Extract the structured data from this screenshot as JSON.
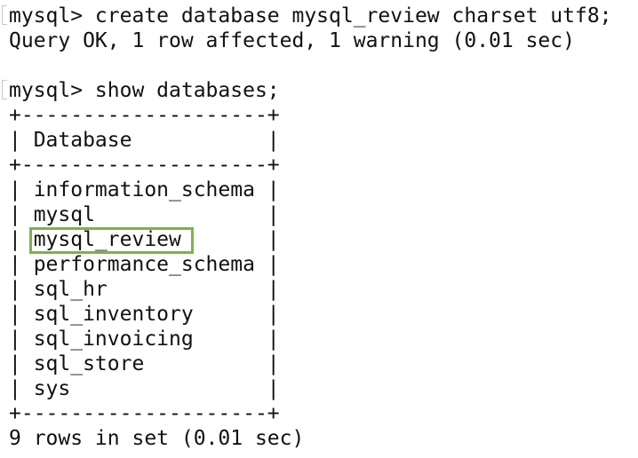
{
  "terminal": {
    "lines": {
      "cmd1": "mysql> create database mysql_review charset utf8;",
      "result1": "Query OK, 1 row affected, 1 warning (0.01 sec)",
      "cmd2": "mysql> show databases;",
      "border_top": "+--------------------+",
      "header": "| Database           |",
      "border_mid": "+--------------------+",
      "rows": [
        "| information_schema |",
        "| mysql              |",
        "| mysql_review       |",
        "| performance_schema |",
        "| sql_hr             |",
        "| sql_inventory      |",
        "| sql_invoicing      |",
        "| sql_store          |",
        "| sys                |"
      ],
      "border_bottom": "+--------------------+",
      "footer": "9 rows in set (0.01 sec)"
    },
    "highlighted_row": "mysql_review",
    "highlight_color": "#7db24a"
  }
}
